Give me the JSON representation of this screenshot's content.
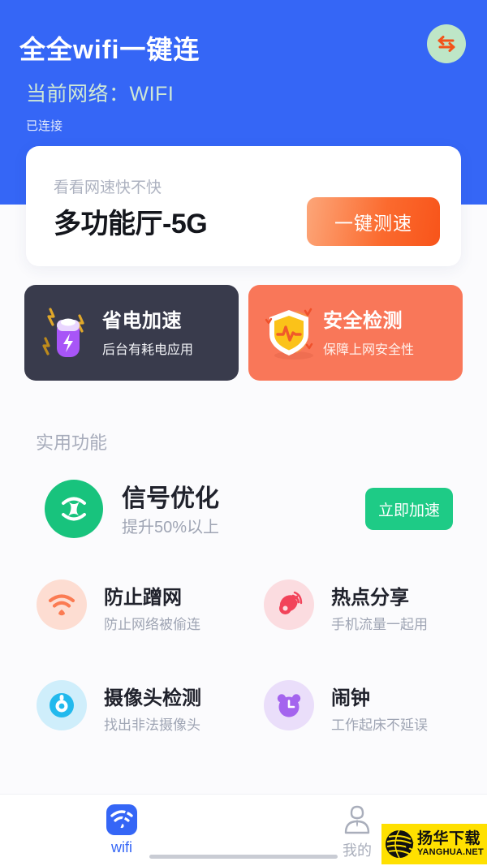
{
  "header": {
    "app_title": "全全wifi一键连",
    "network_line": "当前网络：WIFI",
    "status": "已连接",
    "switch_icon": "swap-arrows-icon",
    "bg_color": "#3566F6"
  },
  "speed_card": {
    "subtitle": "看看网速快不快",
    "network_name": "多功能厅-5G",
    "button_label": "一键测速",
    "button_color": "#FB6A2E"
  },
  "feature_cards": [
    {
      "title": "省电加速",
      "subtitle": "后台有耗电应用",
      "icon": "battery-bolt-icon",
      "bg_color": "#393B4C"
    },
    {
      "title": "安全检测",
      "subtitle": "保障上网安全性",
      "icon": "shield-pulse-icon",
      "bg_color": "#F97759"
    }
  ],
  "section": {
    "title": "实用功能"
  },
  "hero_feature": {
    "title": "信号优化",
    "subtitle": "提升50%以上",
    "icon": "signal-optimize-icon",
    "icon_bg": "#18C37D",
    "button_label": "立即加速",
    "button_color": "#1ECB86"
  },
  "grid": [
    {
      "title": "防止蹭网",
      "subtitle": "防止网络被偷连",
      "icon": "wifi-icon",
      "icon_bg": "#FDDDD2",
      "icon_color": "#FB7B52"
    },
    {
      "title": "热点分享",
      "subtitle": "手机流量一起用",
      "icon": "hotspot-dish-icon",
      "icon_bg": "#FBDCE0",
      "icon_color": "#F2435A"
    },
    {
      "title": "摄像头检测",
      "subtitle": "找出非法摄像头",
      "icon": "camera-detect-icon",
      "icon_bg": "#CFEEFB",
      "icon_color": "#22B9ED"
    },
    {
      "title": "闹钟",
      "subtitle": "工作起床不延误",
      "icon": "alarm-clock-icon",
      "icon_bg": "#EADEFA",
      "icon_color": "#A464EE"
    }
  ],
  "nav": {
    "items": [
      {
        "label": "wifi",
        "icon": "wifi-tab-icon",
        "active": true
      },
      {
        "label": "我的",
        "icon": "person-tab-icon",
        "active": false
      }
    ]
  },
  "watermark": {
    "cn_text": "扬华下载",
    "en_text": "YANGHUA.NET",
    "bg_color": "#FFE000"
  }
}
